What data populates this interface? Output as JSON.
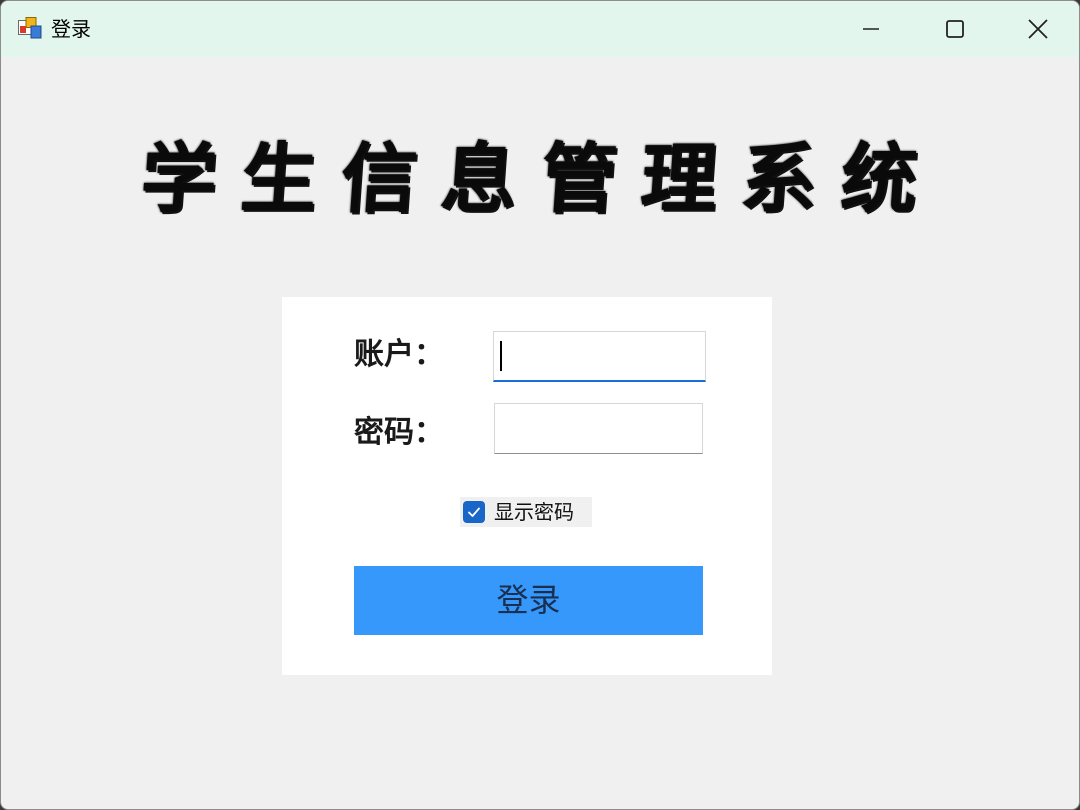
{
  "window": {
    "title": "登录",
    "icon": "app-window-icon",
    "controls": [
      "minimize-icon",
      "maximize-icon",
      "close-icon"
    ]
  },
  "header": {
    "system_title": "学生信息管理系统"
  },
  "form": {
    "account_label": "账户：",
    "account_value": "",
    "password_label": "密码：",
    "password_value": "",
    "show_password_label": "显示密码",
    "show_password_checked": true,
    "login_button_label": "登录"
  },
  "colors": {
    "titlebar": "#e3f6ee",
    "background": "#f0f0f0",
    "panel": "#ffffff",
    "button": "#3598fa",
    "checkbox": "#1966c9",
    "focus_underline": "#1a6dd6"
  }
}
